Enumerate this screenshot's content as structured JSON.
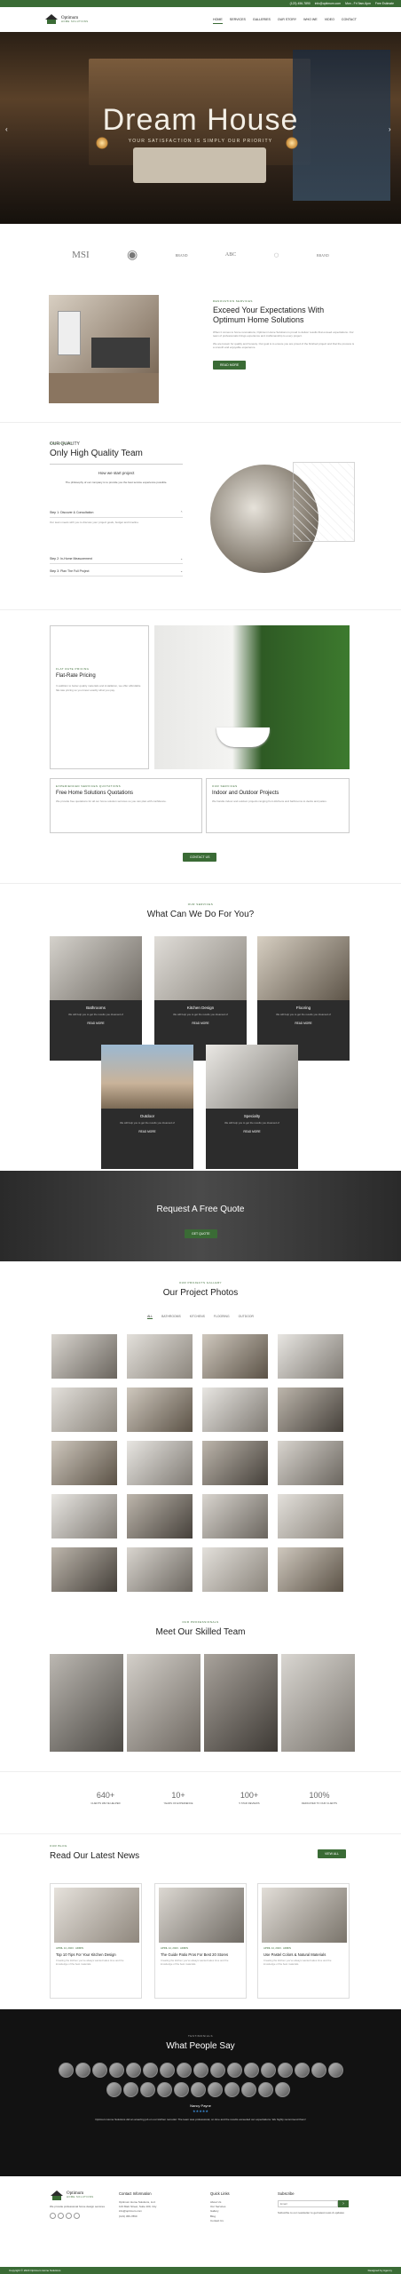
{
  "topbar": {
    "phone": "(123) 456-7890",
    "email": "info@optimum.com",
    "address": "Mon - Fri 9am-6pm",
    "extra": "Free Estimate"
  },
  "nav": {
    "logo_title": "Optimum",
    "logo_sub": "HOME SOLUTIONS",
    "items": [
      "HOME",
      "SERVICES",
      "GALLERIES",
      "OUR STORY",
      "WHO WE",
      "VIDEO",
      "CONTACT"
    ]
  },
  "hero": {
    "title": "Dream House",
    "subtitle": "YOUR SATISFACTION IS SIMPLY OUR PRIORITY"
  },
  "brands": [
    "MSI",
    "◉",
    "BRAND",
    "ABC",
    "◌",
    "BRAND"
  ],
  "intro": {
    "tag": "RENOVATION SERVICES",
    "title": "Exceed Your Expectations With Optimum Home Solutions",
    "p1": "When it comes to home renovations, Optimum Home Solutions is proud to deliver results that exceed expectations. Our team of professionals brings experience and craftsmanship to every project.",
    "p2": "We are known for quality and honesty. Our goal is to ensure you are proud of the finished project and that the process is a smooth and enjoyable experience.",
    "button": "READ MORE"
  },
  "quality": {
    "tag": "OUR QUALITY",
    "title": "Only High Quality Team",
    "question": "How we start project",
    "intro": "The philosophy of our company is to provide you the best service experience possible.",
    "steps": [
      "Step 1: Discover & Consultation",
      "Step 2: In-Home Measurement",
      "Step 3: Plan The Full Project"
    ],
    "step1_text": "Our team meets with you to discuss your project goals, budget and timeline."
  },
  "pricing": {
    "tag": "FLAT RATE PRICING",
    "title": "Flat-Rate Pricing",
    "text": "In addition to better quality materials and installation, we offer affordable flat-rate pricing so you know exactly what you pay.",
    "q_tag": "EXPERIENCED SERVICES QUOTATIONS",
    "q_title": "Free Home Solutions Quotations",
    "q_text": "We provide free quotations for all our home solution services so you can plan with confidence.",
    "io_tag": "OUR SERVICES",
    "io_title": "Indoor and Outdoor Projects",
    "io_text": "We handle indoor and outdoor projects ranging from kitchens and bathrooms to decks and patios.",
    "button": "CONTACT US"
  },
  "services": {
    "tag": "OUR SERVICES",
    "title": "What Can We Do For You?",
    "items": [
      {
        "title": "Bathrooms",
        "desc": "We will help you to get the results you dreamed of",
        "more": "READ MORE"
      },
      {
        "title": "Kitchen Design",
        "desc": "We will help you to get the results you dreamed of",
        "more": "READ MORE"
      },
      {
        "title": "Flooring",
        "desc": "We will help you to get the results you dreamed of",
        "more": "READ MORE"
      },
      {
        "title": "Outdoor",
        "desc": "We will help you to get the results you dreamed of",
        "more": "READ MORE"
      },
      {
        "title": "Specialty",
        "desc": "We will help you to get the results you dreamed of",
        "more": "READ MORE"
      }
    ]
  },
  "quote": {
    "title": "Request A Free Quote",
    "button": "GET QUOTE"
  },
  "gallery": {
    "tag": "OUR PROJECTS GALLERY",
    "title": "Our Project Photos",
    "filters": [
      "ALL",
      "BATHROOMS",
      "KITCHENS",
      "FLOORING",
      "OUTDOOR"
    ]
  },
  "team": {
    "tag": "OUR PROFESSIONALS",
    "title": "Meet Our Skilled Team"
  },
  "stats": [
    {
      "value": "640+",
      "label": "CLIENTS WE'VE HELPED"
    },
    {
      "value": "10+",
      "label": "YEARS OF EXPERIENCE"
    },
    {
      "value": "100+",
      "label": "5 STAR REVIEWS"
    },
    {
      "value": "100%",
      "label": "DEDICATED TO OUR CLIENTS"
    }
  ],
  "news": {
    "tag": "OUR BLOG",
    "title": "Read Our Latest News",
    "button": "VIEW ALL",
    "items": [
      {
        "meta": "APRIL 14, 2023 · ADMIN",
        "title": "Top 10 Tips For Your Kitchen Design",
        "desc": "Creating the kitchen you've always wanted takes time and the knowledge of the best materials."
      },
      {
        "meta": "APRIL 14, 2023 · ADMIN",
        "title": "The Guide Patio Pros For Best 20 Stores",
        "desc": "Creating the kitchen you've always wanted takes time and the knowledge of the best materials."
      },
      {
        "meta": "APRIL 14, 2023 · ADMIN",
        "title": "Use Pastel Colors & Natural Materials",
        "desc": "Creating the kitchen you've always wanted takes time and the knowledge of the best materials."
      }
    ]
  },
  "testimonials": {
    "tag": "TESTIMONIALS",
    "title": "What People Say",
    "name": "Nancy Payne",
    "stars": "★★★★★",
    "quote": "Optimum Home Solutions did an amazing job on our kitchen remodel. The team was professional, on time and the results exceeded our expectations. We highly recommend them!"
  },
  "footer": {
    "about": "We provide professional home design services",
    "contact_head": "Contact Information",
    "contact": [
      "Optimum Home Solutions, LLC",
      "123 Main Street, Suite 100, City",
      "info@optimum.com",
      "(123) 456-7890"
    ],
    "links_head": "Quick Links",
    "links": [
      "About Us",
      "Our Services",
      "Gallery",
      "Blog",
      "Contact Us"
    ],
    "subscribe_head": "Subscribe",
    "subscribe_placeholder": "Email",
    "subscribe_text": "Subscribe to our newsletter to get latest news & updates",
    "copyright": "Copyright © 2023 Optimum Home Solutions",
    "credit": "Designed by Agency"
  },
  "colors": {
    "accent": "#3a6b35",
    "dark": "#121212"
  }
}
